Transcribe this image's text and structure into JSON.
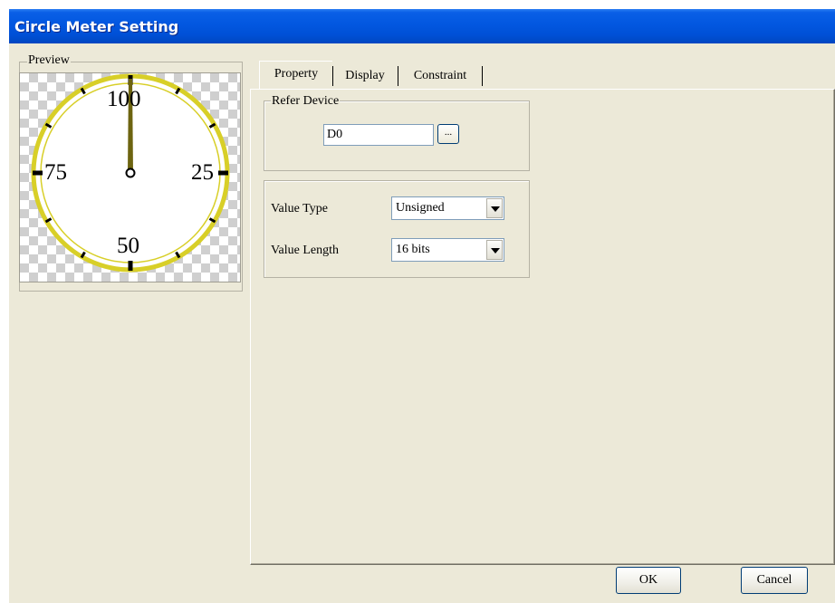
{
  "window": {
    "title": "Circle Meter Setting"
  },
  "preview": {
    "group_label": "Preview",
    "gauge": {
      "labels": [
        "100",
        "25",
        "50",
        "75"
      ],
      "needle_value": 100,
      "ring_color": "#d8cf28",
      "needle_color": "#6d6410"
    }
  },
  "tabs": [
    {
      "label": "Property",
      "active": true
    },
    {
      "label": "Display",
      "active": false
    },
    {
      "label": "Constraint",
      "active": false
    }
  ],
  "refer_device": {
    "group_label": "Refer Device",
    "value": "D0",
    "browse_label": "..."
  },
  "value_settings": {
    "value_type_label": "Value Type",
    "value_type": "Unsigned",
    "value_length_label": "Value Length",
    "value_length": "16 bits"
  },
  "buttons": {
    "ok": "OK",
    "cancel": "Cancel"
  }
}
